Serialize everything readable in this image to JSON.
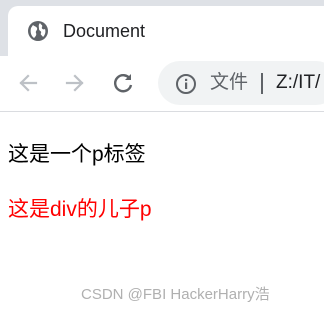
{
  "tab": {
    "title": "Document",
    "favicon": "globe-icon"
  },
  "toolbar": {
    "back_icon": "arrow-left-icon",
    "forward_icon": "arrow-right-icon",
    "reload_icon": "reload-icon",
    "security_icon": "info-icon",
    "security_label": "文件",
    "url": "Z:/IT/"
  },
  "content": {
    "p_text": "这是一个p标签",
    "div_p_text": "这是div的儿子p",
    "div_p_color": "#ff0000"
  },
  "watermark": "CSDN @FBI HackerHarry浩"
}
